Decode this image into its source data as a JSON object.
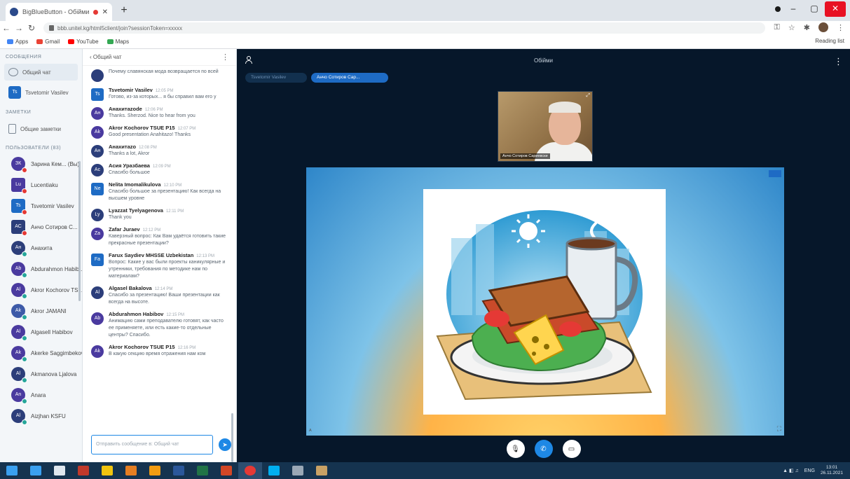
{
  "browser": {
    "tab_title": "BigBlueButton - Обійми",
    "url": "bbb.unitel.kg/html5client/join?sessionToken=xxxxx",
    "bookmarks": [
      "Apps",
      "Gmail",
      "YouTube",
      "Maps"
    ],
    "reading_list": "Reading list"
  },
  "users_panel": {
    "messages_title": "СООБЩЕНИЯ",
    "public_chat": "Общий чат",
    "private_chat_user": "Tsvetomir Vasilev",
    "notes_title": "ЗАМЕТКИ",
    "shared_notes": "Общие заметки",
    "users_title": "ПОЛЬЗОВАТЕЛИ (83)",
    "users": [
      {
        "initials": "ЗК",
        "name": "Зарина Кем... (Вы)",
        "color": "#4a3a9f",
        "status": "#e53935",
        "square": false
      },
      {
        "initials": "Lu",
        "name": "Lucentiaku",
        "color": "#4a3a9f",
        "status": "#e53935",
        "square": true
      },
      {
        "initials": "Ts",
        "name": "Tsvetomir Vasilev",
        "color": "#1e6bc4",
        "status": "#e53935",
        "square": true
      },
      {
        "initials": "АС",
        "name": "Анчо Сотиров С...",
        "color": "#2c3e7a",
        "status": "#e53935",
        "square": true
      },
      {
        "initials": "Ан",
        "name": "Анахита",
        "color": "#2c3e7a",
        "status": "#26a69a",
        "square": false
      },
      {
        "initials": "Ab",
        "name": "Abdurahmon Habib...",
        "color": "#4a3a9f",
        "status": "#26a69a",
        "square": false
      },
      {
        "initials": "Al",
        "name": "Akror Kochorov TS...",
        "color": "#4a3a9f",
        "status": "#26a69a",
        "square": false
      },
      {
        "initials": "Ak",
        "name": "Akror JAMANI",
        "color": "#3d5aa8",
        "status": "#26a69a",
        "square": false
      },
      {
        "initials": "Al",
        "name": "Algasell Habibov",
        "color": "#4a3a9f",
        "status": "#26a69a",
        "square": false
      },
      {
        "initials": "Ak",
        "name": "Akerke Saggimbekov",
        "color": "#4a3a9f",
        "status": "#26a69a",
        "square": false
      },
      {
        "initials": "Al",
        "name": "Akmanova Ljalova",
        "color": "#2c3e7a",
        "status": "#26a69a",
        "square": false
      },
      {
        "initials": "An",
        "name": "Anara",
        "color": "#4a3a9f",
        "status": "#26a69a",
        "square": false
      },
      {
        "initials": "Al",
        "name": "Aizjhan KSFU",
        "color": "#2c3e7a",
        "status": "#26a69a",
        "square": false
      }
    ]
  },
  "chat": {
    "back_label": "‹ Общий чат",
    "messages": [
      {
        "initials": "",
        "name": "",
        "time": "",
        "text": "Почему славянская мода возвращается по всей",
        "style": "navy"
      },
      {
        "initials": "Ts",
        "name": "Tsvetomir Vasilev",
        "time": "12:05 PM",
        "text": "Готово, из-за которых... я бы справил вам его у",
        "style": "blue"
      },
      {
        "initials": "Ан",
        "name": "Анахитаzode",
        "time": "12:06 PM",
        "text": "Thanks. Sherzod. Nice to hear from you",
        "style": "purple"
      },
      {
        "initials": "Ak",
        "name": "Akror Kochorov TSUE P15",
        "time": "12:07 PM",
        "text": "Good presentation Anahitazo! Thanks",
        "style": "purple"
      },
      {
        "initials": "Ан",
        "name": "Анахитаzo",
        "time": "12:08 PM",
        "text": "Thanks a lot, Akror",
        "style": "navy"
      },
      {
        "initials": "Ас",
        "name": "Асия Уразбаева",
        "time": "12:09 PM",
        "text": "Спасибо большое",
        "style": "navy"
      },
      {
        "initials": "Ne",
        "name": "Nelita Imomalikulova",
        "time": "12:10 PM",
        "text": "Спасибо большое за презентацию! Как всегда на высшем уровне",
        "style": "blue"
      },
      {
        "initials": "Ly",
        "name": "Lyazzat Tyelyagenova",
        "time": "12:11 PM",
        "text": "Thank you",
        "style": "navy"
      },
      {
        "initials": "Za",
        "name": "Zafar Juraev",
        "time": "12:12 PM",
        "text": "Каверзный вопрос: Как Вам удаётся готовить такие прекрасные презентации?",
        "style": "purple"
      },
      {
        "initials": "Fa",
        "name": "Farux Saydiev MHSSE Uzbekistan",
        "time": "12:13 PM",
        "text": "Вопрос: Какие у вас были проекты каникулярные и утренники, требования по методике нам по материалам?",
        "style": "blue"
      },
      {
        "initials": "Al",
        "name": "Algasel Bakalova",
        "time": "12:14 PM",
        "text": "Спасибо за презентацию! Ваши презентации как всегда на высоте.",
        "style": "navy"
      },
      {
        "initials": "Ab",
        "name": "Abdurahmon Habibov",
        "time": "12:15 PM",
        "text": "Анимацию сами преподавателю готовят, как часто ее применяете, или есть какие-то отдельные центры? Спасибо.",
        "style": "purple"
      },
      {
        "initials": "Ak",
        "name": "Akror Kochorov TSUE P15",
        "time": "12:16 PM",
        "text": "В какую секцию время отражения нам ком",
        "style": "purple"
      }
    ],
    "input_placeholder": "Отправить сообщение в: Общий чат"
  },
  "main": {
    "title": "Обійми",
    "talkers": [
      "Tsvetomir Vasilev",
      "Анчо Сотиров Сар..."
    ],
    "webcam_label": "Анчо Сотиров Сариевски"
  },
  "taskbar": {
    "apps": [
      {
        "name": "windows-start-icon",
        "color": "#3aa0f0"
      },
      {
        "name": "edge-icon",
        "color": "#3aa0f0"
      },
      {
        "name": "search-icon",
        "color": "#dfe7ef"
      },
      {
        "name": "flag-icon",
        "color": "#c0392b"
      },
      {
        "name": "file-explorer-icon",
        "color": "#f1c40f"
      },
      {
        "name": "firefox-icon",
        "color": "#e67e22"
      },
      {
        "name": "paint-icon",
        "color": "#f39c12"
      },
      {
        "name": "word-icon",
        "color": "#2b579a"
      },
      {
        "name": "excel-icon",
        "color": "#217346"
      },
      {
        "name": "powerpoint-icon",
        "color": "#d24726"
      },
      {
        "name": "chrome-icon",
        "color": "#e53935"
      },
      {
        "name": "skype-icon",
        "color": "#00aff0"
      },
      {
        "name": "app-icon",
        "color": "#9aa8b6"
      },
      {
        "name": "picture-icon",
        "color": "#c8a165"
      }
    ],
    "language": "ENG",
    "time": "13:01",
    "date": "26.11.2021"
  }
}
